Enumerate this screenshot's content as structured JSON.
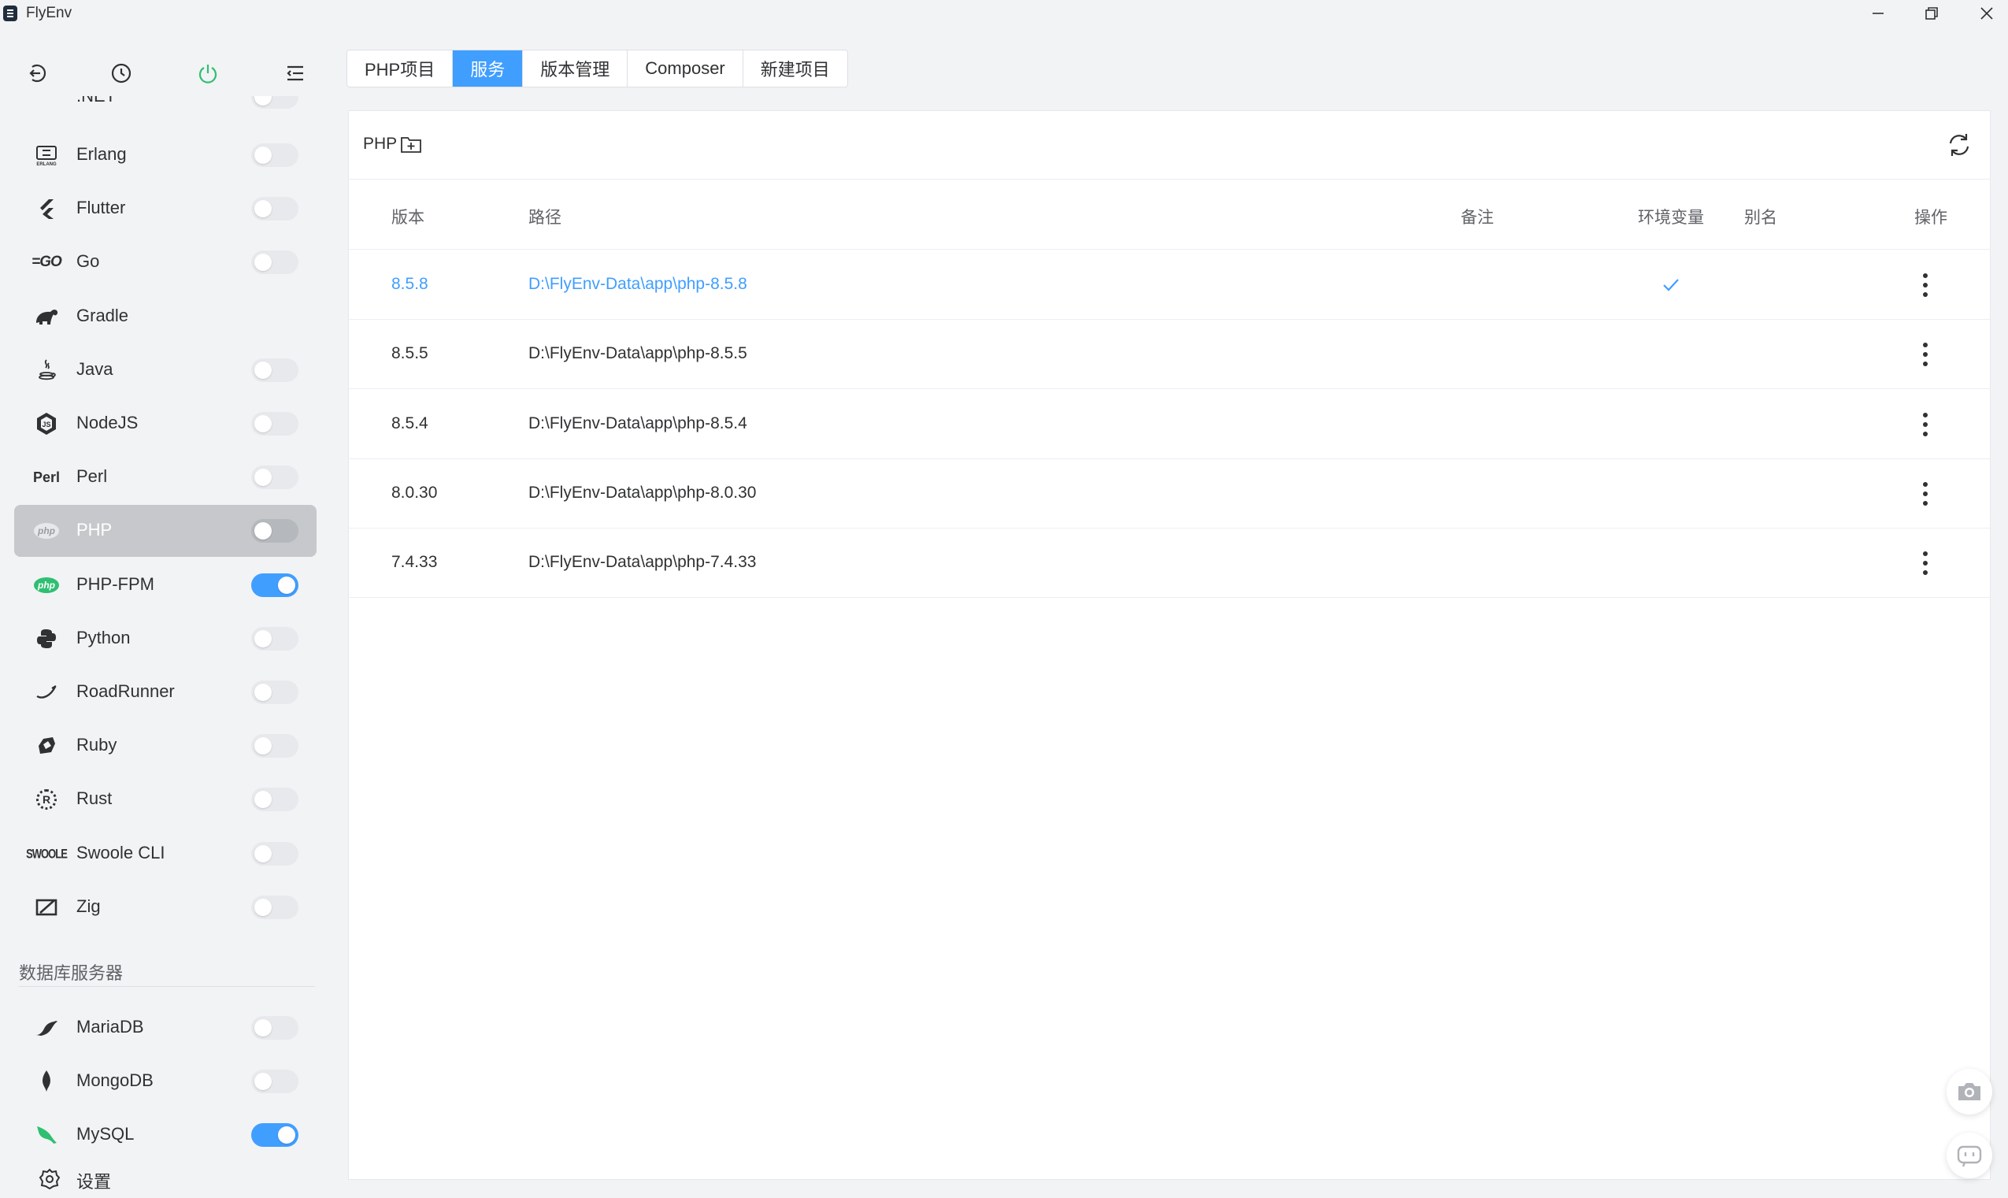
{
  "window": {
    "title": "FlyEnv"
  },
  "sidebar": {
    "partial_item_label": ".NET",
    "items": [
      {
        "label": "Erlang",
        "icon": "erlang-icon",
        "toggle": false,
        "has_toggle": true
      },
      {
        "label": "Flutter",
        "icon": "flutter-icon",
        "toggle": false,
        "has_toggle": true
      },
      {
        "label": "Go",
        "icon": "go-icon",
        "icon_text": "GO",
        "toggle": false,
        "has_toggle": true
      },
      {
        "label": "Gradle",
        "icon": "gradle-icon",
        "has_toggle": false
      },
      {
        "label": "Java",
        "icon": "java-icon",
        "toggle": false,
        "has_toggle": true
      },
      {
        "label": "NodeJS",
        "icon": "nodejs-icon",
        "toggle": false,
        "has_toggle": true
      },
      {
        "label": "Perl",
        "icon": "perl-icon",
        "icon_text": "Perl",
        "toggle": false,
        "has_toggle": true
      },
      {
        "label": "PHP",
        "icon": "php-icon",
        "icon_text": "php",
        "toggle": false,
        "has_toggle": true,
        "active": true
      },
      {
        "label": "PHP-FPM",
        "icon": "php-fpm-icon",
        "icon_text": "php",
        "toggle": true,
        "has_toggle": true
      },
      {
        "label": "Python",
        "icon": "python-icon",
        "toggle": false,
        "has_toggle": true
      },
      {
        "label": "RoadRunner",
        "icon": "roadrunner-icon",
        "toggle": false,
        "has_toggle": true
      },
      {
        "label": "Ruby",
        "icon": "ruby-icon",
        "toggle": false,
        "has_toggle": true
      },
      {
        "label": "Rust",
        "icon": "rust-icon",
        "icon_text": "R",
        "toggle": false,
        "has_toggle": true
      },
      {
        "label": "Swoole CLI",
        "icon": "swoole-icon",
        "icon_text": "SWOOLE",
        "toggle": false,
        "has_toggle": true
      },
      {
        "label": "Zig",
        "icon": "zig-icon",
        "toggle": false,
        "has_toggle": true
      }
    ],
    "db_section_title": "数据库服务器",
    "db_items": [
      {
        "label": "MariaDB",
        "icon": "mariadb-icon",
        "toggle": false
      },
      {
        "label": "MongoDB",
        "icon": "mongodb-icon",
        "toggle": false
      },
      {
        "label": "MySQL",
        "icon": "mysql-icon",
        "toggle": true
      }
    ],
    "settings_label": "设置"
  },
  "tabs": [
    {
      "label": "PHP项目",
      "active": false
    },
    {
      "label": "服务",
      "active": true
    },
    {
      "label": "版本管理",
      "active": false
    },
    {
      "label": "Composer",
      "active": false
    },
    {
      "label": "新建项目",
      "active": false
    }
  ],
  "card": {
    "title": "PHP",
    "columns": {
      "version": "版本",
      "path": "路径",
      "note": "备注",
      "env": "环境变量",
      "alias": "别名",
      "actions": "操作"
    },
    "rows": [
      {
        "version": "8.5.8",
        "path": "D:\\FlyEnv-Data\\app\\php-8.5.8",
        "env": true,
        "current": true
      },
      {
        "version": "8.5.5",
        "path": "D:\\FlyEnv-Data\\app\\php-8.5.5",
        "env": false,
        "current": false
      },
      {
        "version": "8.5.4",
        "path": "D:\\FlyEnv-Data\\app\\php-8.5.4",
        "env": false,
        "current": false
      },
      {
        "version": "8.0.30",
        "path": "D:\\FlyEnv-Data\\app\\php-8.0.30",
        "env": false,
        "current": false
      },
      {
        "version": "7.4.33",
        "path": "D:\\FlyEnv-Data\\app\\php-7.4.33",
        "env": false,
        "current": false
      }
    ]
  },
  "colors": {
    "accent": "#409eff",
    "power": "#2fbf71",
    "php_fpm_icon": "#2fbf71",
    "mysql_icon": "#2fbf71"
  }
}
